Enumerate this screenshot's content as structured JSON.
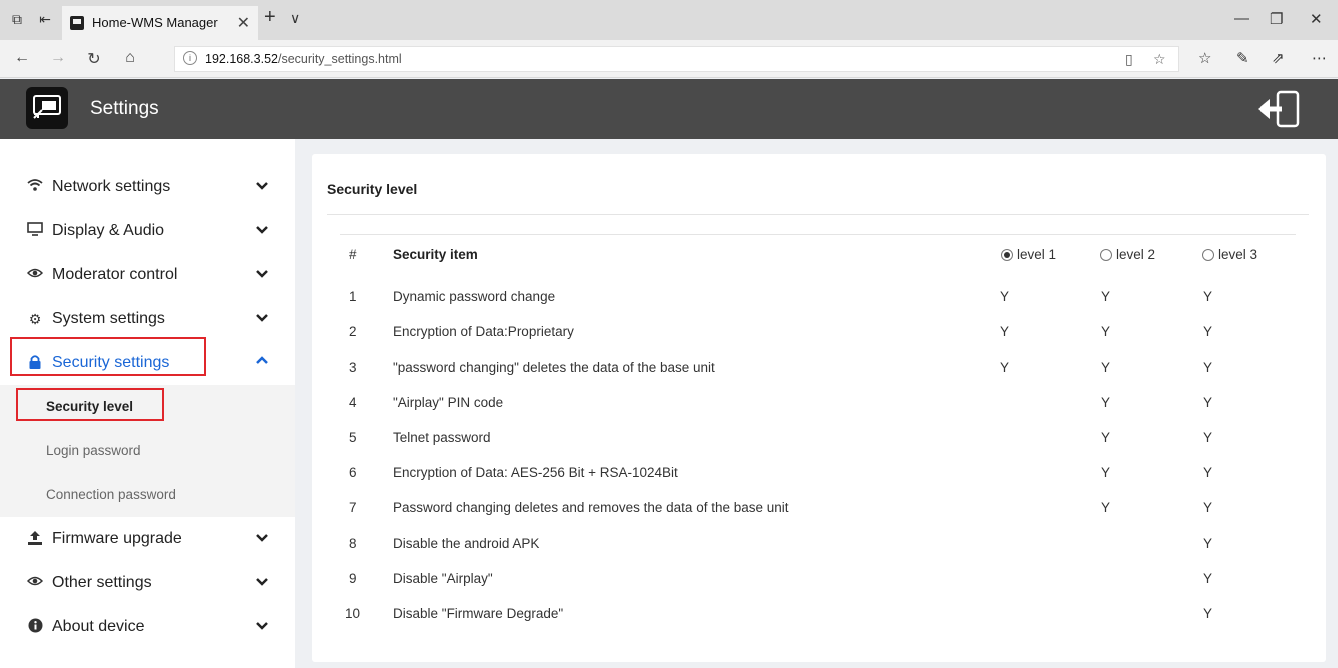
{
  "browser": {
    "tab_title": "Home-WMS Manager",
    "url_host": "192.168.3.52",
    "url_path": "/security_settings.html"
  },
  "app": {
    "title": "Settings"
  },
  "sidebar": {
    "items": [
      {
        "label": "Network settings",
        "icon": "wifi-icon"
      },
      {
        "label": "Display & Audio",
        "icon": "monitor-icon"
      },
      {
        "label": "Moderator control",
        "icon": "eye-icon"
      },
      {
        "label": "System settings",
        "icon": "gear-icon"
      },
      {
        "label": "Security settings",
        "icon": "lock-icon"
      },
      {
        "label": "Firmware upgrade",
        "icon": "upload-icon"
      },
      {
        "label": "Other settings",
        "icon": "eye-icon"
      },
      {
        "label": "About device",
        "icon": "info-icon"
      }
    ],
    "subitems": [
      {
        "label": "Security level"
      },
      {
        "label": "Login password"
      },
      {
        "label": "Connection password"
      }
    ],
    "accent_color": "#1a66d6",
    "highlight_color": "#e0262b"
  },
  "main": {
    "title": "Security level",
    "columns": {
      "num": "#",
      "item": "Security item",
      "level1": "level 1",
      "level2": "level 2",
      "level3": "level 3"
    },
    "selected_level": "level 1",
    "rows": [
      {
        "num": "1",
        "item": "Dynamic password change",
        "l1": "Y",
        "l2": "Y",
        "l3": "Y"
      },
      {
        "num": "2",
        "item": "Encryption of Data:Proprietary",
        "l1": "Y",
        "l2": "Y",
        "l3": "Y"
      },
      {
        "num": "3",
        "item": "\"password changing\" deletes the data of the base unit",
        "l1": "Y",
        "l2": "Y",
        "l3": "Y"
      },
      {
        "num": "4",
        "item": "\"Airplay\" PIN code",
        "l1": "",
        "l2": "Y",
        "l3": "Y"
      },
      {
        "num": "5",
        "item": "Telnet password",
        "l1": "",
        "l2": "Y",
        "l3": "Y"
      },
      {
        "num": "6",
        "item": "Encryption of Data: AES-256 Bit + RSA-1024Bit",
        "l1": "",
        "l2": "Y",
        "l3": "Y"
      },
      {
        "num": "7",
        "item": "Password changing deletes and removes the data of the base unit",
        "l1": "",
        "l2": "Y",
        "l3": "Y"
      },
      {
        "num": "8",
        "item": "Disable the android APK",
        "l1": "",
        "l2": "",
        "l3": "Y"
      },
      {
        "num": "9",
        "item": "Disable \"Airplay\"",
        "l1": "",
        "l2": "",
        "l3": "Y"
      },
      {
        "num": "10",
        "item": "Disable \"Firmware Degrade\"",
        "l1": "",
        "l2": "",
        "l3": "Y"
      }
    ]
  }
}
